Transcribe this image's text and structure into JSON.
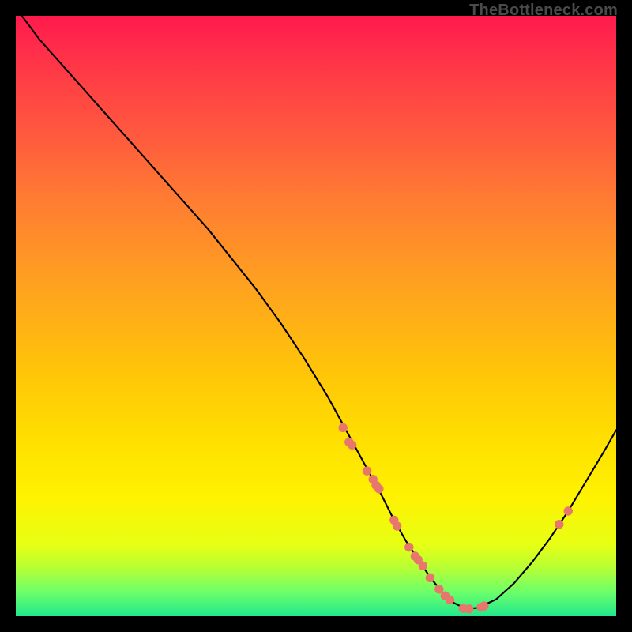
{
  "watermark": "TheBottleneck.com",
  "chart_data": {
    "type": "line",
    "title": "",
    "xlabel": "",
    "ylabel": "",
    "xlim": [
      0,
      100
    ],
    "ylim": [
      0,
      100
    ],
    "curve": {
      "name": "bottleneck-curve",
      "x": [
        1,
        4,
        8,
        12,
        16,
        20,
        24,
        28,
        32,
        36,
        40,
        44,
        48,
        52,
        55,
        58,
        61,
        63,
        65,
        67,
        69,
        71,
        73,
        75,
        77,
        80,
        83,
        86,
        89,
        92,
        95,
        98,
        100
      ],
      "y": [
        100,
        96,
        91.5,
        87,
        82.5,
        78,
        73.5,
        69,
        64.5,
        59.5,
        54.5,
        49,
        43,
        36.5,
        31,
        25.5,
        20,
        16,
        12.5,
        9.5,
        6.5,
        4,
        2.2,
        1.2,
        1.4,
        2.8,
        5.5,
        9,
        13,
        17.5,
        22.5,
        27.5,
        31
      ]
    },
    "points": {
      "name": "marked-points",
      "color": "#e7766c",
      "x": [
        54.5,
        55.5,
        56.0,
        58.5,
        59.5,
        60.0,
        60.5,
        63.0,
        63.5,
        65.5,
        66.5,
        67.0,
        67.8,
        69.0,
        70.5,
        71.5,
        72.3,
        74.5,
        75.5,
        77.5,
        78.0,
        90.5,
        92.0
      ],
      "y": [
        31.4,
        29.0,
        28.5,
        24.2,
        22.8,
        21.8,
        21.2,
        16.0,
        15.0,
        11.5,
        10.0,
        9.4,
        8.4,
        6.4,
        4.5,
        3.4,
        2.7,
        1.3,
        1.2,
        1.5,
        1.7,
        15.3,
        17.5
      ]
    }
  }
}
